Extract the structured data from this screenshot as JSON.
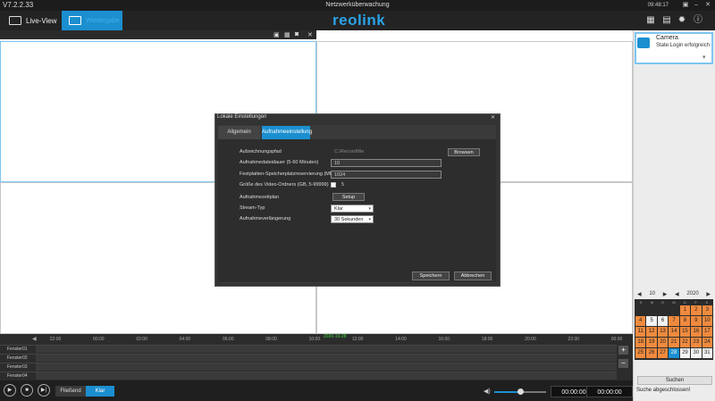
{
  "app": {
    "version": "V7.2.2.33",
    "title": "Netzwerküberwachung",
    "clock": "09:48:17",
    "logo": "reolink"
  },
  "toolbar": {
    "live_view": "Live-View",
    "playback": "Wiedergabe"
  },
  "camera": {
    "name": "Camera",
    "state": "State:Login erfolgreich"
  },
  "calendar": {
    "month": "10",
    "year": "2020",
    "dow": [
      "S",
      "M",
      "D",
      "M",
      "D",
      "F",
      "S"
    ],
    "days": [
      {
        "d": "",
        "t": "empty"
      },
      {
        "d": "",
        "t": "empty"
      },
      {
        "d": "",
        "t": "empty"
      },
      {
        "d": "",
        "t": "empty"
      },
      {
        "d": "1",
        "t": "rec"
      },
      {
        "d": "2",
        "t": "rec"
      },
      {
        "d": "3",
        "t": "rec"
      },
      {
        "d": "4",
        "t": "rec"
      },
      {
        "d": "5",
        "t": "plain"
      },
      {
        "d": "6",
        "t": "plain"
      },
      {
        "d": "7",
        "t": "rec"
      },
      {
        "d": "8",
        "t": "rec"
      },
      {
        "d": "9",
        "t": "rec"
      },
      {
        "d": "10",
        "t": "rec"
      },
      {
        "d": "11",
        "t": "rec"
      },
      {
        "d": "12",
        "t": "rec"
      },
      {
        "d": "13",
        "t": "rec"
      },
      {
        "d": "14",
        "t": "rec"
      },
      {
        "d": "15",
        "t": "rec"
      },
      {
        "d": "16",
        "t": "rec"
      },
      {
        "d": "17",
        "t": "rec"
      },
      {
        "d": "18",
        "t": "rec"
      },
      {
        "d": "19",
        "t": "rec"
      },
      {
        "d": "20",
        "t": "rec"
      },
      {
        "d": "21",
        "t": "rec"
      },
      {
        "d": "22",
        "t": "rec"
      },
      {
        "d": "23",
        "t": "rec"
      },
      {
        "d": "24",
        "t": "rec"
      },
      {
        "d": "25",
        "t": "rec"
      },
      {
        "d": "26",
        "t": "rec"
      },
      {
        "d": "27",
        "t": "rec"
      },
      {
        "d": "28",
        "t": "sel"
      },
      {
        "d": "29",
        "t": "plain"
      },
      {
        "d": "30",
        "t": "plain"
      },
      {
        "d": "31",
        "t": "plain"
      }
    ],
    "search": "Suchen",
    "status": "Suche abgeschlossen!"
  },
  "timeline": {
    "date": "2020-10-28",
    "ticks": [
      "22:00",
      "00:00",
      "02:00",
      "04:00",
      "06:00",
      "08:00",
      "10:00",
      "12:00",
      "14:00",
      "16:00",
      "18:00",
      "20:00",
      "22:30",
      "00:00"
    ],
    "rows": [
      "Fenster01",
      "Fenster02",
      "Fenster03",
      "Fenster04"
    ]
  },
  "controls": {
    "stream_fluent": "Fließend",
    "stream_clear": "Klar",
    "time_start": "00:00:00",
    "time_end": "00:00:00",
    "volume_level": 0.5
  },
  "dialog": {
    "title": "Lokale Einstellungen",
    "tabs": [
      "Allgemein",
      "Aufnahmeeinstellung"
    ],
    "fields": {
      "path_label": "Aufzeichnungspfad",
      "path_value": "C:\\Record\\file",
      "browse": "Browsen",
      "duration_label": "Aufnahmedateidauer (5-60 Minuten)",
      "duration_value": "10",
      "disk_label": "Festplatten-Speicherplatzreservierung (MB)",
      "disk_value": "1024",
      "size_label": "Größe des Video-Ordners (GB, 5-99999)",
      "size_value": "5",
      "schedule_label": "Aufnahmezeitplan",
      "setup": "Setup",
      "stream_label": "Stream-Typ",
      "stream_value": "Klar",
      "ext_label": "Aufnahmeverlängerung",
      "ext_value": "30 Sekunden"
    },
    "save": "Speichern",
    "cancel": "Abbrechen"
  }
}
